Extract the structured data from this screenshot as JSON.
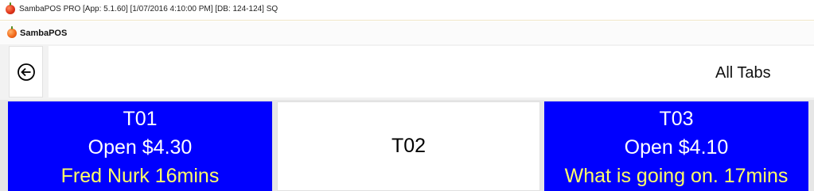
{
  "window": {
    "title": "SambaPOS PRO [App: 5.1.60] [1/07/2016 4:10:00 PM] [DB: 124-124] SQ"
  },
  "app": {
    "name": "SambaPOS",
    "logo_icon": "apple-icon"
  },
  "toolbar": {
    "back_icon": "back-arrow-icon",
    "header_title": "All Tabs"
  },
  "tiles": [
    {
      "name": "T01",
      "status": "Open $4.30",
      "note": "Fred Nurk 16mins",
      "background": "#0000ff",
      "text_color": "#ffffff",
      "note_color": "#ffff66"
    },
    {
      "name": "T02",
      "background": "#ffffff",
      "text_color": "#000000"
    },
    {
      "name": "T03",
      "status": "Open $4.10",
      "note": "What is going on. 17mins",
      "background": "#0000ff",
      "text_color": "#ffffff",
      "note_color": "#ffff66"
    }
  ]
}
